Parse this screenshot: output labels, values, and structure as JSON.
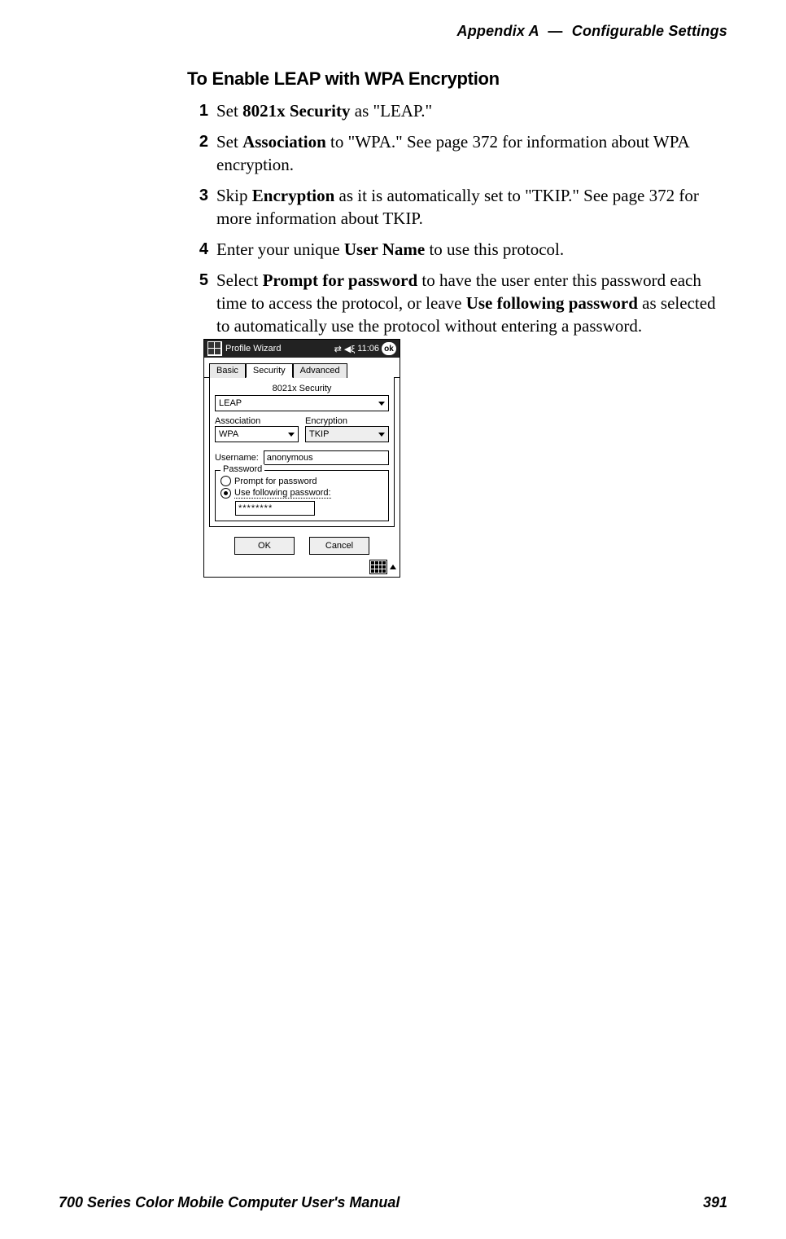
{
  "header": {
    "appendix": "Appendix A",
    "dash": "—",
    "section": "Configurable Settings"
  },
  "title": "To Enable LEAP with WPA Encryption",
  "steps": [
    {
      "n": "1",
      "pre": "Set ",
      "bold": "8021x Security",
      "post": " as \"LEAP.\""
    },
    {
      "n": "2",
      "pre": "Set ",
      "bold": "Association",
      "post": " to \"WPA.\" See page 372 for information about WPA encryption."
    },
    {
      "n": "3",
      "pre": "Skip ",
      "bold": "Encryption",
      "post": " as it is automatically set to \"TKIP.\" See page 372 for more information about TKIP."
    },
    {
      "n": "4",
      "pre": "Enter your unique ",
      "bold": "User Name",
      "post": " to use this protocol."
    },
    {
      "n": "5",
      "pre": "Select ",
      "bold": "Prompt for password",
      "post_a": " to have the user enter this password each time to access the protocol, or leave ",
      "bold_b": "Use following password",
      "post_b": " as selected to automatically use the protocol without entering a password."
    }
  ],
  "screenshot": {
    "window_title": "Profile Wizard",
    "time": "11:06",
    "ok": "ok",
    "tabs": {
      "basic": "Basic",
      "security": "Security",
      "advanced": "Advanced"
    },
    "labels": {
      "sec8021x": "8021x Security",
      "association": "Association",
      "encryption": "Encryption",
      "username": "Username:",
      "password_group": "Password",
      "prompt": "Prompt for password",
      "usefollow": "Use following password:"
    },
    "values": {
      "sec8021x": "LEAP",
      "association": "WPA",
      "encryption": "TKIP",
      "username": "anonymous",
      "password": "********"
    },
    "buttons": {
      "ok": "OK",
      "cancel": "Cancel"
    }
  },
  "footer": {
    "left": "700 Series Color Mobile Computer User's Manual",
    "right": "391"
  }
}
